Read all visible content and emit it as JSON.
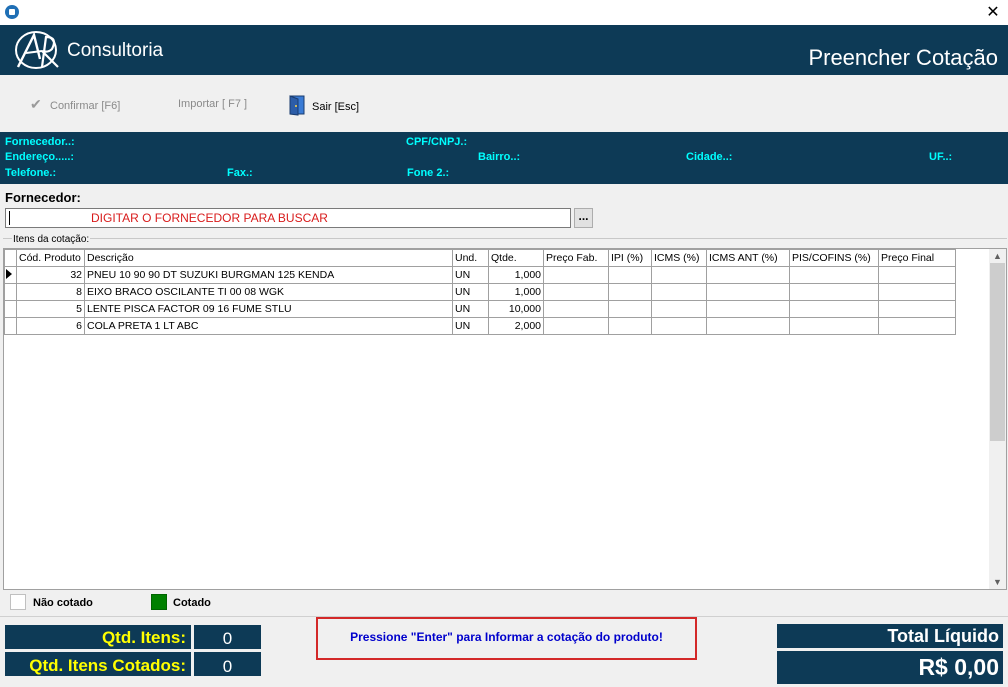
{
  "window": {
    "close_glyph": "✕"
  },
  "header": {
    "logo_text": "Consultoria",
    "page_title": "Preencher Cotação"
  },
  "toolbar": {
    "confirmar_label": "Confirmar [F6]",
    "importar_label": "Importar  [ F7 ]",
    "sair_label": "Sair [Esc]"
  },
  "supplier_info": {
    "fornecedor": "Fornecedor..:",
    "cpf_cnpj": "CPF/CNPJ.:",
    "endereco": "Endereço.....:",
    "bairro": "Bairro..:",
    "cidade": "Cidade..:",
    "uf": "UF..:",
    "telefone": "Telefone.:",
    "fax": "Fax.:",
    "fone2": "Fone 2.:"
  },
  "search": {
    "label": "Fornecedor:",
    "placeholder_text": "DIGITAR O FORNECEDOR PARA BUSCAR",
    "lookup_button": "..."
  },
  "grid": {
    "group_label": "Itens da cotação:",
    "columns": [
      "Cód. Produto",
      "Descrição",
      "Und.",
      "Qtde.",
      "Preço Fab.",
      "IPI (%)",
      "ICMS (%)",
      "ICMS ANT (%)",
      "PIS/COFINS (%)",
      "Preço Final"
    ],
    "rows": [
      {
        "codigo": "32",
        "descricao": "PNEU 10 90 90 DT  SUZUKI BURGMAN 125 KENDA",
        "und": "UN",
        "qtde": "1,000"
      },
      {
        "codigo": "8",
        "descricao": "EIXO BRACO OSCILANTE TI 00 08 WGK",
        "und": "UN",
        "qtde": "1,000"
      },
      {
        "codigo": "5",
        "descricao": "LENTE PISCA FACTOR 09 16 FUME STLU",
        "und": "UN",
        "qtde": "10,000"
      },
      {
        "codigo": "6",
        "descricao": "COLA PRETA 1 LT ABC",
        "und": "UN",
        "qtde": "2,000"
      }
    ]
  },
  "legend": {
    "nao_cotado": "Não cotado",
    "cotado": "Cotado",
    "cotado_color": "#008000"
  },
  "footer": {
    "qtd_itens_label": "Qtd. Itens:",
    "qtd_itens_value": "0",
    "qtd_cotados_label": "Qtd. Itens Cotados:",
    "qtd_cotados_value": "0",
    "hint": "Pressione \"Enter\" para Informar a cotação do produto!",
    "total_label": "Total Líquido",
    "total_value": "R$ 0,00"
  },
  "colors": {
    "brand": "#0d3a56",
    "info_label": "#00ffff",
    "footer_label": "#ffff00",
    "hint_text": "#0000cc",
    "hint_border": "#d32828"
  }
}
